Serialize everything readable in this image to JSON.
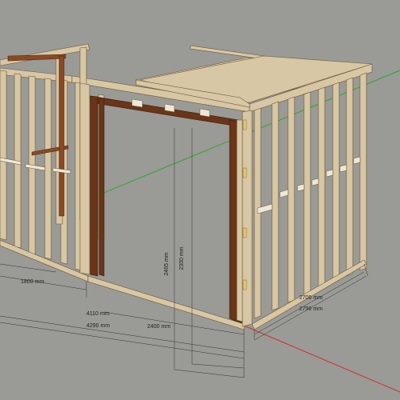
{
  "app": {
    "type": "3D modeling viewport"
  },
  "colors": {
    "background": "#9a9a96",
    "timber_light": "#d8c7a4",
    "timber_edge": "#6b5636",
    "timber_dark": "#6a3518",
    "axis_green": "#29a829",
    "axis_red": "#d23030",
    "axis_blue": "#3070d0"
  },
  "dimensions": {
    "d1800": "1800 mm",
    "d4110": "4110 mm",
    "d4290": "4290 mm",
    "d2400": "2400 mm",
    "d2300": "2300 mm",
    "d2465": "2465 mm",
    "d2700": "2700 mm",
    "d2790": "2790 mm"
  }
}
